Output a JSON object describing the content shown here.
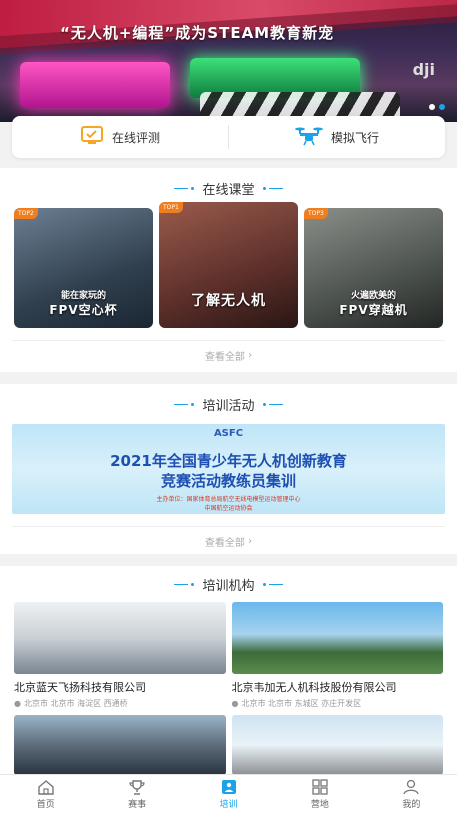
{
  "banner": {
    "title": "“无人机+编程”成为STEAM教育新宠",
    "brand": "dji",
    "dots": 2,
    "active_dot": 1
  },
  "quick_actions": [
    {
      "label": "在线评测",
      "icon": "monitor-check-icon"
    },
    {
      "label": "模拟飞行",
      "icon": "drone-icon"
    }
  ],
  "online_class": {
    "title": "在线课堂",
    "items": [
      {
        "tag": "TOP2",
        "line1": "能在家玩的",
        "line2": "FPV空心杯"
      },
      {
        "tag": "TOP1",
        "line1": "",
        "line2": "了解无人机"
      },
      {
        "tag": "TOP3",
        "line1": "火遍欧美的",
        "line2": "FPV穿越机"
      }
    ],
    "more": "查看全部"
  },
  "training": {
    "title": "培训活动",
    "banner": {
      "logo": "ASFC",
      "line1": "2021年全国青少年无人机创新教育",
      "line2": "竞赛活动教练员集训",
      "host": "主办单位：国家体育总局航空无线电模型运动管理中心",
      "host2": "中国航空运动协会"
    },
    "more": "查看全部"
  },
  "institutions": {
    "title": "培训机构",
    "items": [
      {
        "name": "北京蓝天飞扬科技有限公司",
        "location": "北京市 北京市 海淀区  西通桥"
      },
      {
        "name": "北京韦加无人机科技股份有限公司",
        "location": "北京市 北京市 东城区 亦庄开发区"
      },
      {
        "name": "",
        "location": ""
      },
      {
        "name": "",
        "location": ""
      }
    ]
  },
  "tabbar": [
    {
      "label": "首页",
      "icon": "home-icon"
    },
    {
      "label": "赛事",
      "icon": "trophy-icon"
    },
    {
      "label": "培训",
      "icon": "training-icon",
      "active": true
    },
    {
      "label": "营地",
      "icon": "grid-icon"
    },
    {
      "label": "我的",
      "icon": "user-icon"
    }
  ],
  "colors": {
    "accent": "#1aa3e8",
    "tag": "#f07e1e",
    "quick_eval_icon": "#f5a623",
    "quick_fly_icon": "#1aa3e8"
  }
}
